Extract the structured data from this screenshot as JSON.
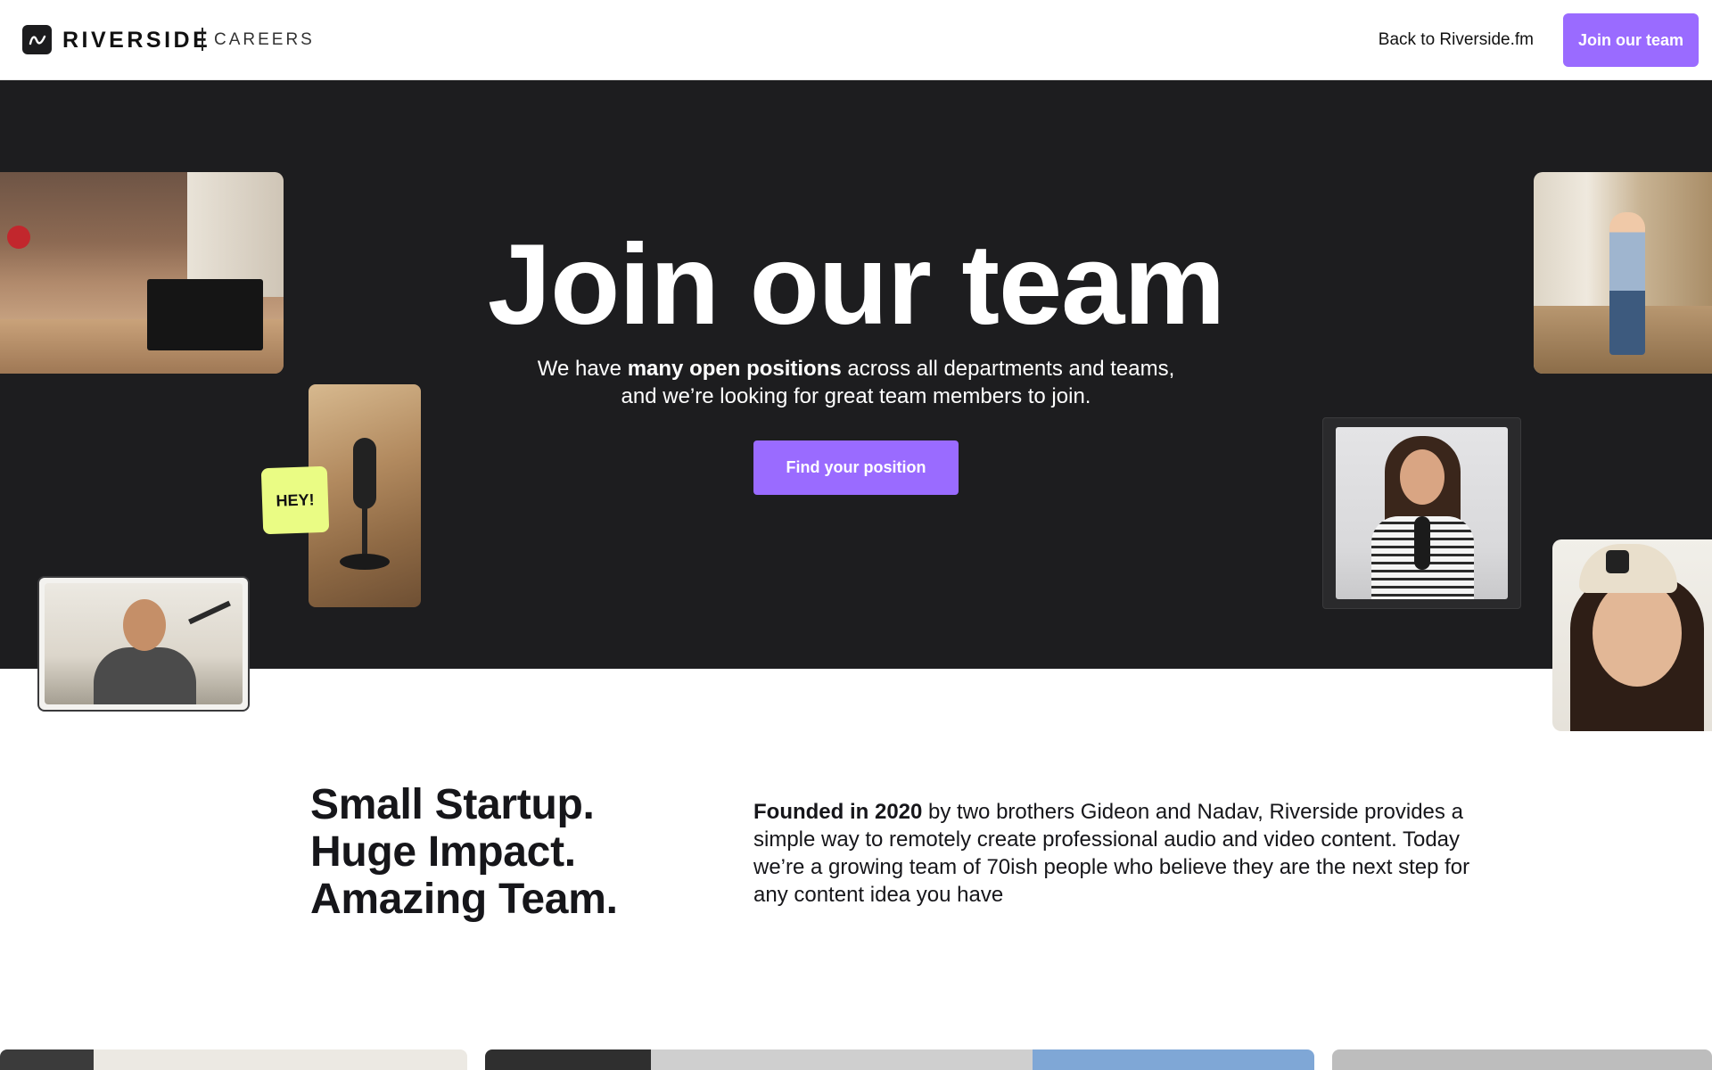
{
  "nav": {
    "brand": "RIVERSIDE",
    "brand_sub": "CAREERS",
    "back_link": "Back to Riverside.fm",
    "cta": "Join our team"
  },
  "hero": {
    "title": "Join our team",
    "subtitle_prefix": "We have ",
    "subtitle_bold": "many open positions",
    "subtitle_suffix": " across all departments and teams,",
    "subtitle_line2": "and we’re looking for great team members to join.",
    "cta": "Find your position",
    "sticky_note": "HEY!"
  },
  "about": {
    "heading_lines": [
      "Small Startup.",
      "Huge Impact.",
      "Amazing Team."
    ],
    "text_bold": "Founded in 2020",
    "text_rest": " by two brothers Gideon and Nadav, Riverside provides a simple way to remotely create professional audio and video content. Today we’re a growing team of 70ish people who believe  they are the next step for any content idea you have"
  },
  "colors": {
    "accent": "#9a6bff",
    "hero_bg": "#1d1d1f",
    "note": "#eafc84"
  },
  "icons": {
    "logo": "riverside-wave-icon"
  }
}
